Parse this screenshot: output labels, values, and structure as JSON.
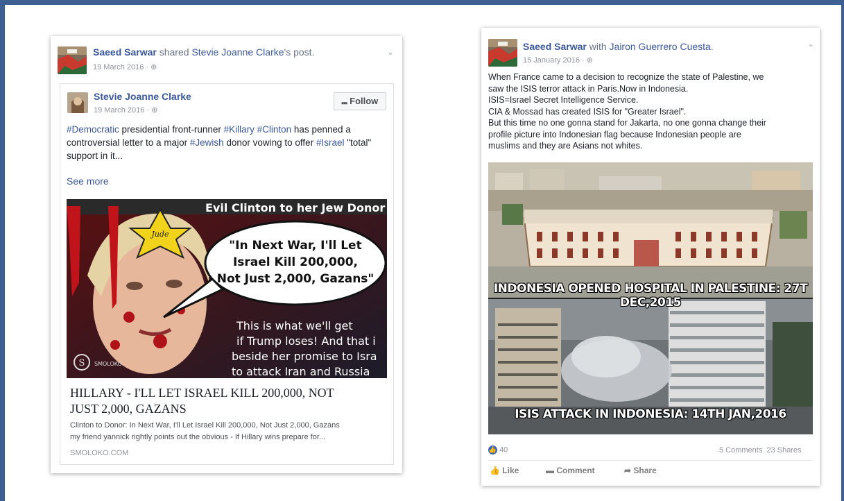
{
  "left_post": {
    "author": "Saeed Sarwar",
    "action": " shared ",
    "shared_author": "Stevie Joanne Clarke",
    "shared_suffix": "'s post.",
    "date": "19 March 2016 · ",
    "globe_icon": "globe-icon",
    "shared": {
      "author": "Stevie Joanne Clarke",
      "date": "19 March 2016 · ",
      "follow_label": "Follow",
      "text_parts": [
        {
          "t": "#Democratic",
          "tag": true
        },
        {
          "t": " presidential front-runner ",
          "tag": false
        },
        {
          "t": "#Killary",
          "tag": true
        },
        {
          "t": " ",
          "tag": false
        },
        {
          "t": "#Clinton",
          "tag": true
        },
        {
          "t": " has penned a controversial letter to a major ",
          "tag": false
        },
        {
          "t": "#Jewish",
          "tag": true
        },
        {
          "t": " donor vowing to offer ",
          "tag": false
        },
        {
          "t": "#Israel",
          "tag": true
        },
        {
          "t": " \"total\" support in it...",
          "tag": false
        }
      ],
      "see_more": "See more",
      "image": {
        "top_text": "Evil Clinton to her Jew Donor",
        "star_label": "Jude",
        "bubble_lines": [
          "\"In Next War, I'll Let",
          "Israel Kill 200,000,",
          "Not Just 2,000, Gazans\""
        ],
        "caption_lines": [
          "This is what we'll get",
          "if Trump loses! And that i",
          "beside her promise to Isra",
          "to attack Iran and Russia"
        ],
        "logo": "SMOLOKO"
      },
      "link_title_lines": [
        "HILLARY - I'LL LET ISRAEL KILL 200,000, NOT",
        "JUST 2,000, GAZANS"
      ],
      "link_desc_lines": [
        "Clinton to Donor: In Next War, I'll Let Israel Kill 200,000, Not Just 2,000, Gazans",
        "my friend yannick rightly points out the obvious - If Hillary wins prepare for..."
      ],
      "link_domain": "SMOLOKO.COM"
    }
  },
  "right_post": {
    "author": "Saeed Sarwar",
    "with": " with ",
    "tagged": "Jairon Guerrero Cuesta",
    "tagged_suffix": ".",
    "date": "15 January 2016 · ",
    "text_lines": [
      "When France came to a decision to recognize the state of Palestine, we",
      "saw the ISIS terror attack in Paris.Now in Indonesia.",
      "ISIS=Israel Secret Intelligence Service.",
      "CIA & Mossad has created ISIS for \"Greater Israel\".",
      "But this time no one gonna stand for Jakarta, no one gonna change their",
      "profile picture into Indonesian flag because Indonesian people are",
      "muslims and they are Asians not whites."
    ],
    "banner_top": "INDONESIA OPENED HOSPITAL IN PALESTINE: 27T DEC,2015",
    "banner_bottom": "ISIS ATTACK IN INDONESIA: 14TH JAN,2016",
    "likes": "40",
    "comments": "5 Comments",
    "shares": "23 Shares",
    "like_label": "Like",
    "comment_label": "Comment",
    "share_label": "Share"
  },
  "colors": {
    "frame": "#3d5f92",
    "link": "#3b5998"
  }
}
